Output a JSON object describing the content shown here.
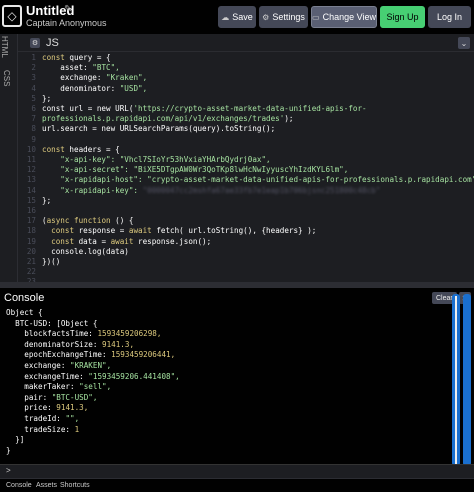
{
  "header": {
    "title": "Untitled",
    "owner": "Captain Anonymous",
    "logo_icon": "codepen-logo-icon",
    "buttons": {
      "save": "Save",
      "settings": "Settings",
      "change_view": "Change View",
      "signup": "Sign Up",
      "login": "Log In"
    }
  },
  "side_tabs": {
    "html": "HTML",
    "css": "CSS"
  },
  "editor": {
    "label": "JS",
    "lines": [
      {
        "n": "1"
      },
      {
        "n": "2"
      },
      {
        "n": "3"
      },
      {
        "n": "4"
      },
      {
        "n": "5"
      },
      {
        "n": "6"
      },
      {
        "n": "7"
      },
      {
        "n": "8"
      },
      {
        "n": "9"
      },
      {
        "n": "10"
      },
      {
        "n": "11"
      },
      {
        "n": "12"
      },
      {
        "n": "13"
      },
      {
        "n": "14"
      },
      {
        "n": "15"
      },
      {
        "n": "16"
      },
      {
        "n": "17"
      },
      {
        "n": "18"
      },
      {
        "n": "19"
      },
      {
        "n": "20"
      },
      {
        "n": "21"
      },
      {
        "n": "22"
      },
      {
        "n": "23"
      }
    ],
    "code": {
      "l1": "const query = {",
      "l2a": "    asset: ",
      "l2b": "\"BTC\",",
      "l3a": "    exchange: ",
      "l3b": "\"Kraken\",",
      "l4a": "    denominator: ",
      "l4b": "\"USD\",",
      "l5": "};",
      "l6a": "const url = new URL(",
      "l6b": "'https://crypto-asset-market-data-unified-apis-for-",
      "l7a": "professionals.p.rapidapi.com/api/v1/exchanges/trades'",
      "l7b": ");",
      "l8": "url.search = new URLSearchParams(query).toString();",
      "l9": "",
      "l10": "const headers = {",
      "l11a": "    \"x-api-key\": ",
      "l11b": "\"Vhcl7SIoYr53hVxiaYHArbQydrj0ax\",",
      "l12a": "    \"x-api-secret\": ",
      "l12b": "\"BiXE5DTgpAW0Wr3QoTKp8lwHcNwIyyuscYhIzdKYL6lm\",",
      "l13a": "    \"x-rapidapi-host\": ",
      "l13b": "\"crypto-asset-market-data-unified-apis-for-professionals.p.rapidapi.com\",",
      "l14a": "    \"x-rapidapi-key\": ",
      "l14b": "\"0000047cc2mshfa67ae33fb7e1eap1b706bjsnc251800c48cb\"",
      "l15": "};",
      "l16": "",
      "l17": "(async function () {",
      "l18": "  const response = await fetch( url.toString(), {headers} );",
      "l19": "  const data = await response.json();",
      "l20": "  console.log(data)",
      "l21": "})()",
      "l22": "",
      "l23": ""
    }
  },
  "console": {
    "title": "Console",
    "clear": "Clear",
    "close_icon": "close-icon",
    "output": {
      "c1": "Object {",
      "c2": "  BTC-USD: [Object {",
      "c3k": "    blockfactsTime: ",
      "c3v": "1593459206298,",
      "c4k": "    denominatorSize: ",
      "c4v": "9141.3,",
      "c5k": "    epochExchangeTime: ",
      "c5v": "1593459206441,",
      "c6k": "    exchange: ",
      "c6v": "\"KRAKEN\",",
      "c7k": "    exchangeTime: ",
      "c7v": "\"1593459206.441408\",",
      "c8k": "    makerTaker: ",
      "c8v": "\"sell\",",
      "c9k": "    pair: ",
      "c9v": "\"BTC-USD\",",
      "c10k": "    price: ",
      "c10v": "9141.3,",
      "c11k": "    tradeId: ",
      "c11v": "\"\",",
      "c12k": "    tradeSize: ",
      "c12v": "1",
      "c13": "  }]",
      "c14": "}"
    },
    "prompt": ">"
  },
  "footer": {
    "tabs": [
      "Console",
      "Assets",
      "Shortcuts"
    ]
  }
}
